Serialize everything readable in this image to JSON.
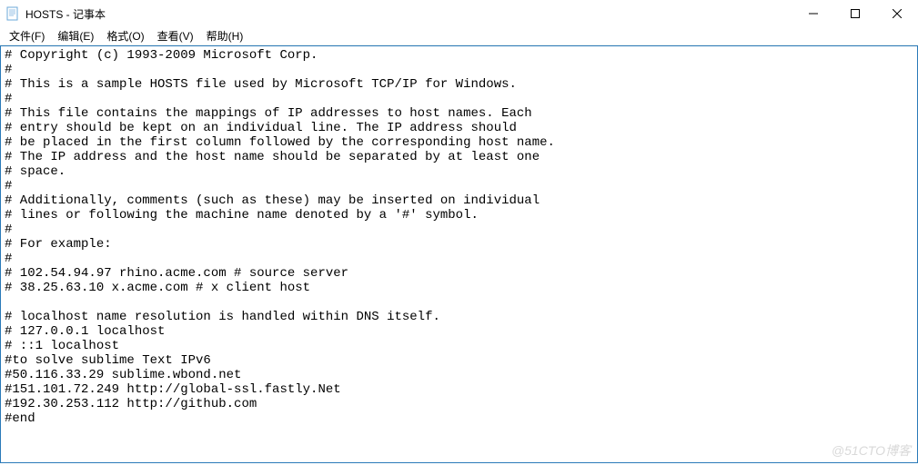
{
  "window": {
    "title": "HOSTS - 记事本"
  },
  "menu": {
    "file": "文件(F)",
    "edit": "编辑(E)",
    "format": "格式(O)",
    "view": "查看(V)",
    "help": "帮助(H)"
  },
  "content": "# Copyright (c) 1993-2009 Microsoft Corp.\n#\n# This is a sample HOSTS file used by Microsoft TCP/IP for Windows.\n#\n# This file contains the mappings of IP addresses to host names. Each\n# entry should be kept on an individual line. The IP address should\n# be placed in the first column followed by the corresponding host name.\n# The IP address and the host name should be separated by at least one\n# space.\n#\n# Additionally, comments (such as these) may be inserted on individual\n# lines or following the machine name denoted by a '#' symbol.\n#\n# For example:\n#\n# 102.54.94.97 rhino.acme.com # source server\n# 38.25.63.10 x.acme.com # x client host\n\n# localhost name resolution is handled within DNS itself.\n# 127.0.0.1 localhost\n# ::1 localhost\n#to solve sublime Text IPv6\n#50.116.33.29 sublime.wbond.net\n#151.101.72.249 http://global-ssl.fastly.Net\n#192.30.253.112 http://github.com\n#end",
  "watermark": "@51CTO博客"
}
